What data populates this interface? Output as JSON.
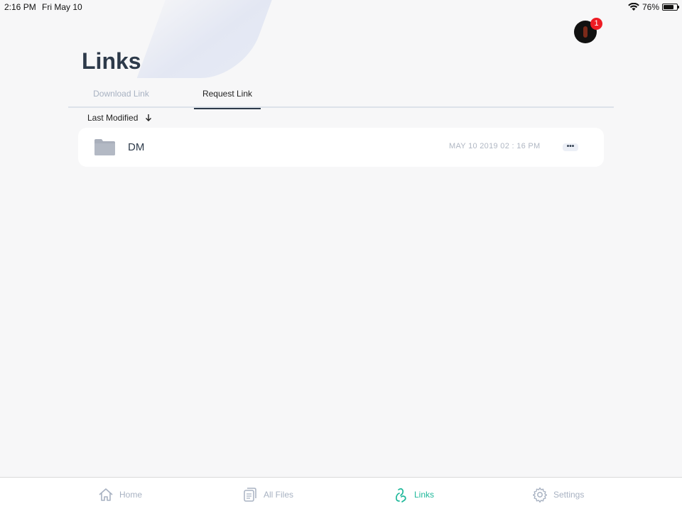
{
  "status_bar": {
    "time": "2:16 PM",
    "date": "Fri May 10",
    "battery": "76%",
    "battery_level": 0.76
  },
  "header": {
    "title": "Links",
    "notification_count": "1"
  },
  "tabs": [
    {
      "label": "Download Link",
      "active": false
    },
    {
      "label": "Request Link",
      "active": true
    }
  ],
  "sort": {
    "label": "Last Modified",
    "direction_icon": "arrow-down-icon"
  },
  "items": [
    {
      "name": "DM",
      "date": "MAY 10 2019 02 : 16 PM",
      "icon": "folder-icon",
      "more": "•••"
    }
  ],
  "tabbar": {
    "home": "Home",
    "all_files": "All Files",
    "links": "Links",
    "settings": "Settings"
  },
  "colors": {
    "accent": "#1fb89a",
    "badge": "#ee1c24",
    "title": "#2d3a4a",
    "inactive": "#a8b2c2"
  }
}
